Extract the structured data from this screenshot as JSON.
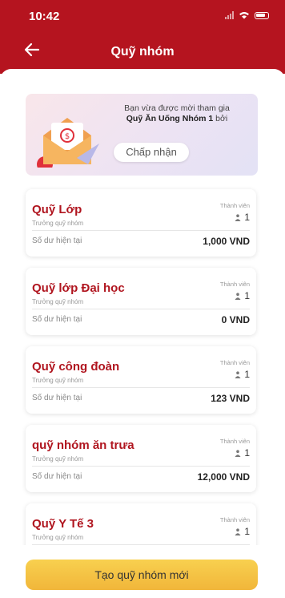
{
  "status_bar": {
    "time": "10:42"
  },
  "header": {
    "title": "Quỹ nhóm"
  },
  "invite_banner": {
    "line1": "Bạn vừa được mời tham gia",
    "fund_name": "Quỹ Ăn Uống Nhóm 1",
    "line2_suffix": " bởi",
    "accept_label": "Chấp nhận"
  },
  "labels": {
    "role": "Trưởng quỹ nhóm",
    "members": "Thành viên",
    "balance": "Số dư hiện tại"
  },
  "funds": [
    {
      "name": "Quỹ Lớp",
      "members": "1",
      "balance": "1,000 VND"
    },
    {
      "name": "Quỹ lớp Đại học",
      "members": "1",
      "balance": "0 VND"
    },
    {
      "name": "Quỹ công đoàn",
      "members": "1",
      "balance": "123 VND"
    },
    {
      "name": "quỹ nhóm ăn trưa",
      "members": "1",
      "balance": "12,000 VND"
    },
    {
      "name": "Quỹ Y Tế 3",
      "members": "1",
      "balance": ""
    }
  ],
  "footer": {
    "create_label": "Tạo quỹ nhóm mới"
  },
  "colors": {
    "brand": "#b5141f",
    "button": "#f4c143"
  }
}
